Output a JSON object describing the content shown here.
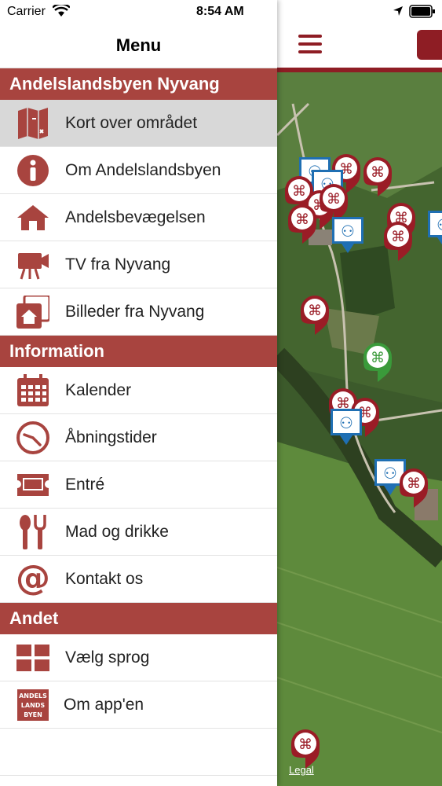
{
  "status_bar": {
    "carrier": "Carrier",
    "time": "8:54 AM"
  },
  "menu": {
    "title": "Menu",
    "sections": [
      {
        "title": "Andelslandsbyen Nyvang",
        "items": [
          {
            "label": "Kort over området",
            "icon": "map-icon",
            "active": true
          },
          {
            "label": "Om Andelslandsbyen",
            "icon": "info-icon"
          },
          {
            "label": "Andelsbevægelsen",
            "icon": "house-icon"
          },
          {
            "label": "TV fra Nyvang",
            "icon": "video-camera-icon"
          },
          {
            "label": "Billeder fra Nyvang",
            "icon": "photo-gallery-icon"
          }
        ]
      },
      {
        "title": "Information",
        "items": [
          {
            "label": "Kalender",
            "icon": "calendar-icon"
          },
          {
            "label": "Åbningstider",
            "icon": "clock-icon"
          },
          {
            "label": "Entré",
            "icon": "ticket-icon"
          },
          {
            "label": "Mad og drikke",
            "icon": "food-icon"
          },
          {
            "label": "Kontakt os",
            "icon": "at-icon"
          }
        ]
      },
      {
        "title": "Andet",
        "items": [
          {
            "label": "Vælg sprog",
            "icon": "language-grid-icon"
          },
          {
            "label": "Om app'en",
            "icon": "app-logo-icon",
            "logo_text": [
              "ANDELS",
              "LANDS",
              "BYEN"
            ]
          }
        ]
      }
    ]
  },
  "map": {
    "legal_label": "Legal"
  },
  "colors": {
    "brand": "#8e1d24",
    "section_bg": "#a8443f",
    "marker_red": "#9a1c26",
    "marker_blue": "#1f6fb3",
    "marker_green": "#3a9a3a"
  }
}
